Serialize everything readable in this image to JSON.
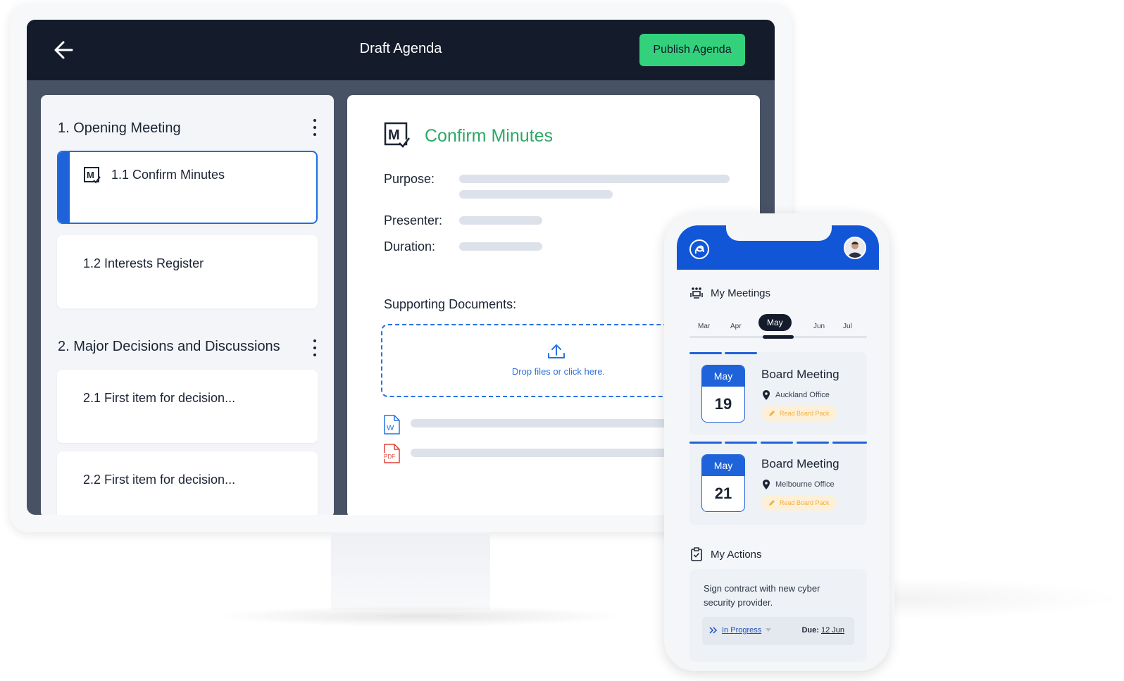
{
  "desktop": {
    "header": {
      "title": "Draft Agenda",
      "back_icon": "arrow-left-icon",
      "publish_label": "Publish Agenda",
      "publish_color": "#34d17c"
    },
    "agenda": {
      "sections": [
        {
          "title": "1.  Opening Meeting",
          "items": [
            {
              "label": "1.1  Confirm Minutes",
              "icon": "minutes-icon",
              "active": true
            },
            {
              "label": "1.2  Interests Register"
            }
          ]
        },
        {
          "title": "2.  Major Decisions and Discussions",
          "items": [
            {
              "label": "2.1  First item for decision..."
            },
            {
              "label": "2.2  First item for decision..."
            }
          ]
        }
      ]
    },
    "detail": {
      "title": "Confirm Minutes",
      "title_color": "#2ea866",
      "purpose_label": "Purpose:",
      "presenter_label": "Presenter:",
      "duration_label": "Duration:",
      "supporting_label": "Supporting Documents:",
      "drop_text": "Drop files or click here.",
      "documents": [
        {
          "icon": "word-doc-icon"
        },
        {
          "icon": "pdf-doc-icon"
        }
      ]
    }
  },
  "mobile": {
    "my_meetings": "My Meetings",
    "months": [
      "Mar",
      "Apr",
      "May",
      "Jun",
      "Jul"
    ],
    "selected_month": "May",
    "meetings": [
      {
        "month": "May",
        "day": "19",
        "title": "Board Meeting",
        "location": "Auckland Office",
        "action": "Read Board Pack"
      },
      {
        "month": "May",
        "day": "21",
        "title": "Board Meeting",
        "location": "Melbourne Office",
        "action": "Read Board Pack"
      }
    ],
    "my_actions": "My Actions",
    "action": {
      "text": "Sign contract with new cyber security provider.",
      "status": "In Progress",
      "due_label": "Due:",
      "due_value": "12 Jun"
    }
  },
  "colors": {
    "accent_blue": "#1f63da",
    "dark_navy": "#141c2c"
  }
}
